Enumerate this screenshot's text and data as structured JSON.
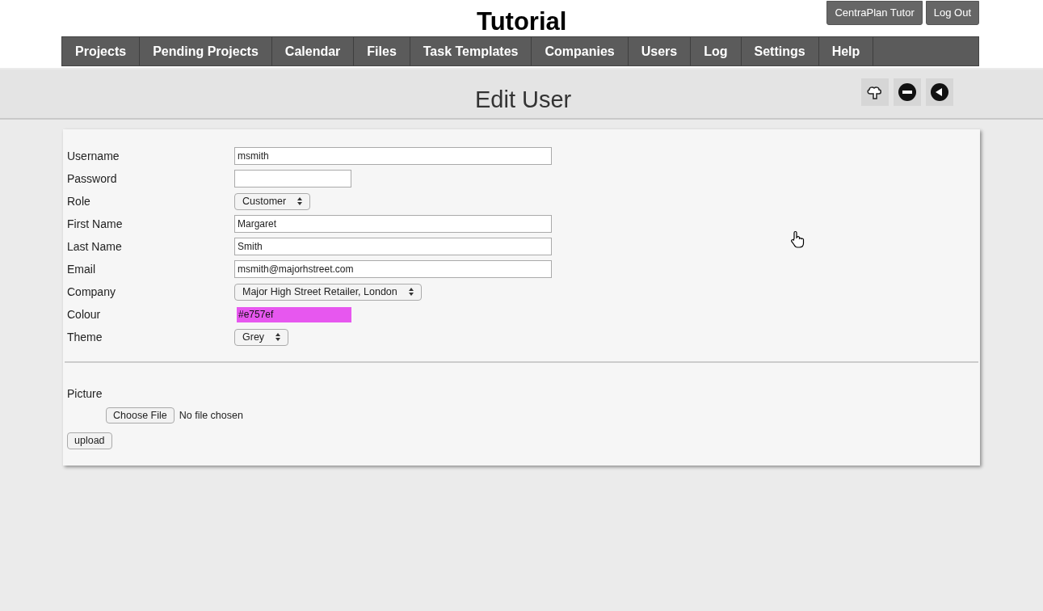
{
  "header": {
    "title": "Tutorial",
    "account_buttons": [
      "CentraPlan Tutor",
      "Log Out"
    ]
  },
  "nav": [
    {
      "label": "Projects"
    },
    {
      "label": "Pending Projects"
    },
    {
      "label": "Calendar"
    },
    {
      "label": "Files"
    },
    {
      "label": "Task Templates"
    },
    {
      "label": "Companies"
    },
    {
      "label": "Users"
    },
    {
      "label": "Log"
    },
    {
      "label": "Settings"
    },
    {
      "label": "Help"
    }
  ],
  "page_title": "Edit User",
  "form": {
    "fields": [
      {
        "label": "Username",
        "kind": "text",
        "value": "msmith"
      },
      {
        "label": "Password",
        "kind": "password"
      },
      {
        "label": "Role",
        "kind": "select",
        "value": "Customer"
      },
      {
        "label": "First Name",
        "kind": "text",
        "value": "Margaret"
      },
      {
        "label": "Last Name",
        "kind": "text",
        "value": "Smith"
      },
      {
        "label": "Email",
        "kind": "text",
        "value": "msmith@majorhstreet.com"
      },
      {
        "label": "Company",
        "kind": "select",
        "value": "Major High Street Retailer, London"
      },
      {
        "label": "Colour",
        "kind": "color",
        "value": "#e757ef",
        "color": "#e757ef"
      },
      {
        "label": "Theme",
        "kind": "select",
        "value": "Grey"
      }
    ],
    "picture": {
      "label": "Picture",
      "choose_button": "Choose File",
      "file_status": "No file chosen",
      "upload_button": "upload"
    }
  }
}
